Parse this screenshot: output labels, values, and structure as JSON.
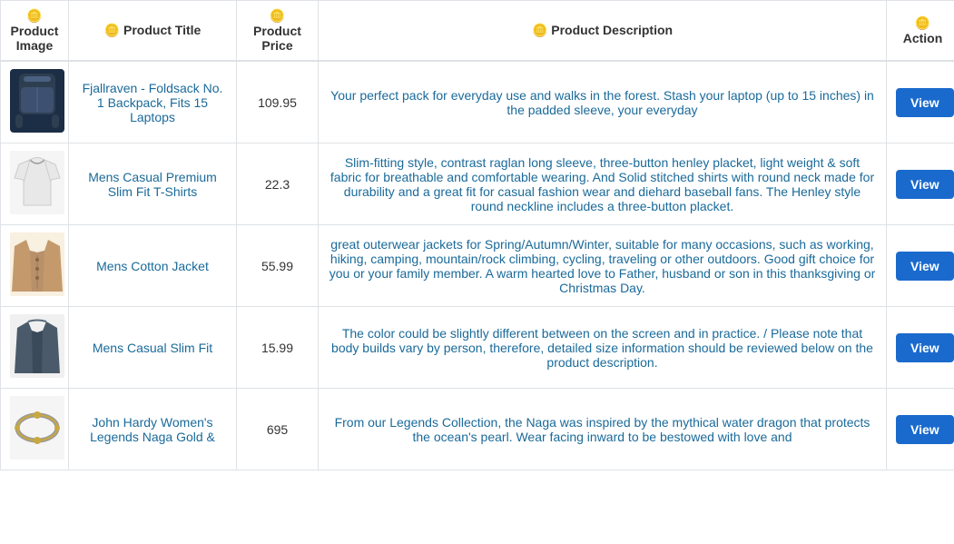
{
  "table": {
    "columns": [
      {
        "key": "image",
        "label": "Product Image",
        "icon": "🪙"
      },
      {
        "key": "title",
        "label": "Product Title",
        "icon": "🪙"
      },
      {
        "key": "price",
        "label": "Product Price",
        "icon": "🪙"
      },
      {
        "key": "description",
        "label": "Product Description",
        "icon": "🪙"
      },
      {
        "key": "action",
        "label": "Action",
        "icon": "🪙"
      }
    ],
    "rows": [
      {
        "id": 1,
        "image_alt": "Fjallraven Backpack",
        "image_type": "backpack",
        "title": "Fjallraven - Foldsack No. 1 Backpack, Fits 15 Laptops",
        "price": "109.95",
        "description": "Your perfect pack for everyday use and walks in the forest. Stash your laptop (up to 15 inches) in the padded sleeve, your everyday",
        "action_label": "View"
      },
      {
        "id": 2,
        "image_alt": "Mens Casual T-Shirt",
        "image_type": "tshirt",
        "title": "Mens Casual Premium Slim Fit T-Shirts",
        "price": "22.3",
        "description": "Slim-fitting style, contrast raglan long sleeve, three-button henley placket, light weight & soft fabric for breathable and comfortable wearing. And Solid stitched shirts with round neck made for durability and a great fit for casual fashion wear and diehard baseball fans. The Henley style round neckline includes a three-button placket.",
        "action_label": "View"
      },
      {
        "id": 3,
        "image_alt": "Mens Cotton Jacket",
        "image_type": "jacket",
        "title": "Mens Cotton Jacket",
        "price": "55.99",
        "description": "great outerwear jackets for Spring/Autumn/Winter, suitable for many occasions, such as working, hiking, camping, mountain/rock climbing, cycling, traveling or other outdoors. Good gift choice for you or your family member. A warm hearted love to Father, husband or son in this thanksgiving or Christmas Day.",
        "action_label": "View"
      },
      {
        "id": 4,
        "image_alt": "Mens Casual Slim Fit",
        "image_type": "slim",
        "title": "Mens Casual Slim Fit",
        "price": "15.99",
        "description": "The color could be slightly different between on the screen and in practice. / Please note that body builds vary by person, therefore, detailed size information should be reviewed below on the product description.",
        "action_label": "View"
      },
      {
        "id": 5,
        "image_alt": "John Hardy Women Bracelet",
        "image_type": "bracelet",
        "title": "John Hardy Women's Legends Naga Gold &",
        "price": "695",
        "description": "From our Legends Collection, the Naga was inspired by the mythical water dragon that protects the ocean's pearl. Wear facing inward to be bestowed with love and",
        "action_label": "View"
      }
    ]
  }
}
